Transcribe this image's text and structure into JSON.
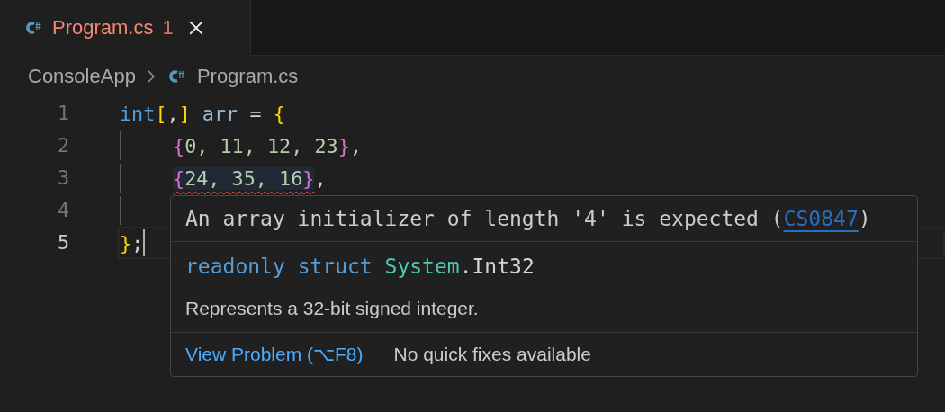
{
  "tab": {
    "title": "Program.cs",
    "problems": "1"
  },
  "breadcrumb": {
    "folder": "ConsoleApp",
    "file": "Program.cs"
  },
  "lines": [
    {
      "number": "1",
      "current": false,
      "tokens": [
        {
          "text": "int",
          "kind": "keyword",
          "error": false
        },
        {
          "text": "[",
          "kind": "bracket1",
          "error": false
        },
        {
          "text": ",",
          "kind": "punct",
          "error": false
        },
        {
          "text": "]",
          "kind": "bracket1",
          "error": false
        },
        {
          "text": " arr ",
          "kind": "variable",
          "error": false
        },
        {
          "text": "= ",
          "kind": "punct",
          "error": false
        },
        {
          "text": "{",
          "kind": "bracket1",
          "error": false
        }
      ],
      "children": [
        {
          "number": "2",
          "current": false,
          "tokens": [
            {
              "text": "{",
              "kind": "bracket2",
              "error": false
            },
            {
              "text": "0, 11, 12, 23",
              "kind": "number",
              "error": false
            },
            {
              "text": "}",
              "kind": "bracket2",
              "error": false
            },
            {
              "text": ",",
              "kind": "punct",
              "error": false
            }
          ]
        },
        {
          "number": "3",
          "current": false,
          "tokens": [
            {
              "text": "{",
              "kind": "bracket2",
              "error": true
            },
            {
              "text": "24, 35, 16",
              "kind": "number",
              "error": true
            },
            {
              "text": "}",
              "kind": "bracket2",
              "error": true
            },
            {
              "text": ",",
              "kind": "punct",
              "error": false
            }
          ]
        },
        {
          "number": "4",
          "current": false
        }
      ]
    },
    {
      "number": "5",
      "current": true,
      "tokens": [
        {
          "text": "}",
          "kind": "bracket1",
          "error": false
        },
        {
          "text": ";",
          "kind": "punct",
          "error": false
        }
      ]
    }
  ],
  "hover": {
    "message": "An array initializer of length '4' is expected (",
    "code": "CS0847",
    "message_end": ")",
    "signature": [
      {
        "text": "readonly ",
        "kind": "keyword"
      },
      {
        "text": "struct ",
        "kind": "keyword"
      },
      {
        "text": "System",
        "kind": "type"
      },
      {
        "text": ".",
        "kind": "punct"
      },
      {
        "text": "Int32",
        "kind": "punct"
      }
    ],
    "description": "Represents a 32-bit signed integer.",
    "view_problem": "View Problem (⌥F8)",
    "quick_fixes": "No quick fixes available"
  }
}
